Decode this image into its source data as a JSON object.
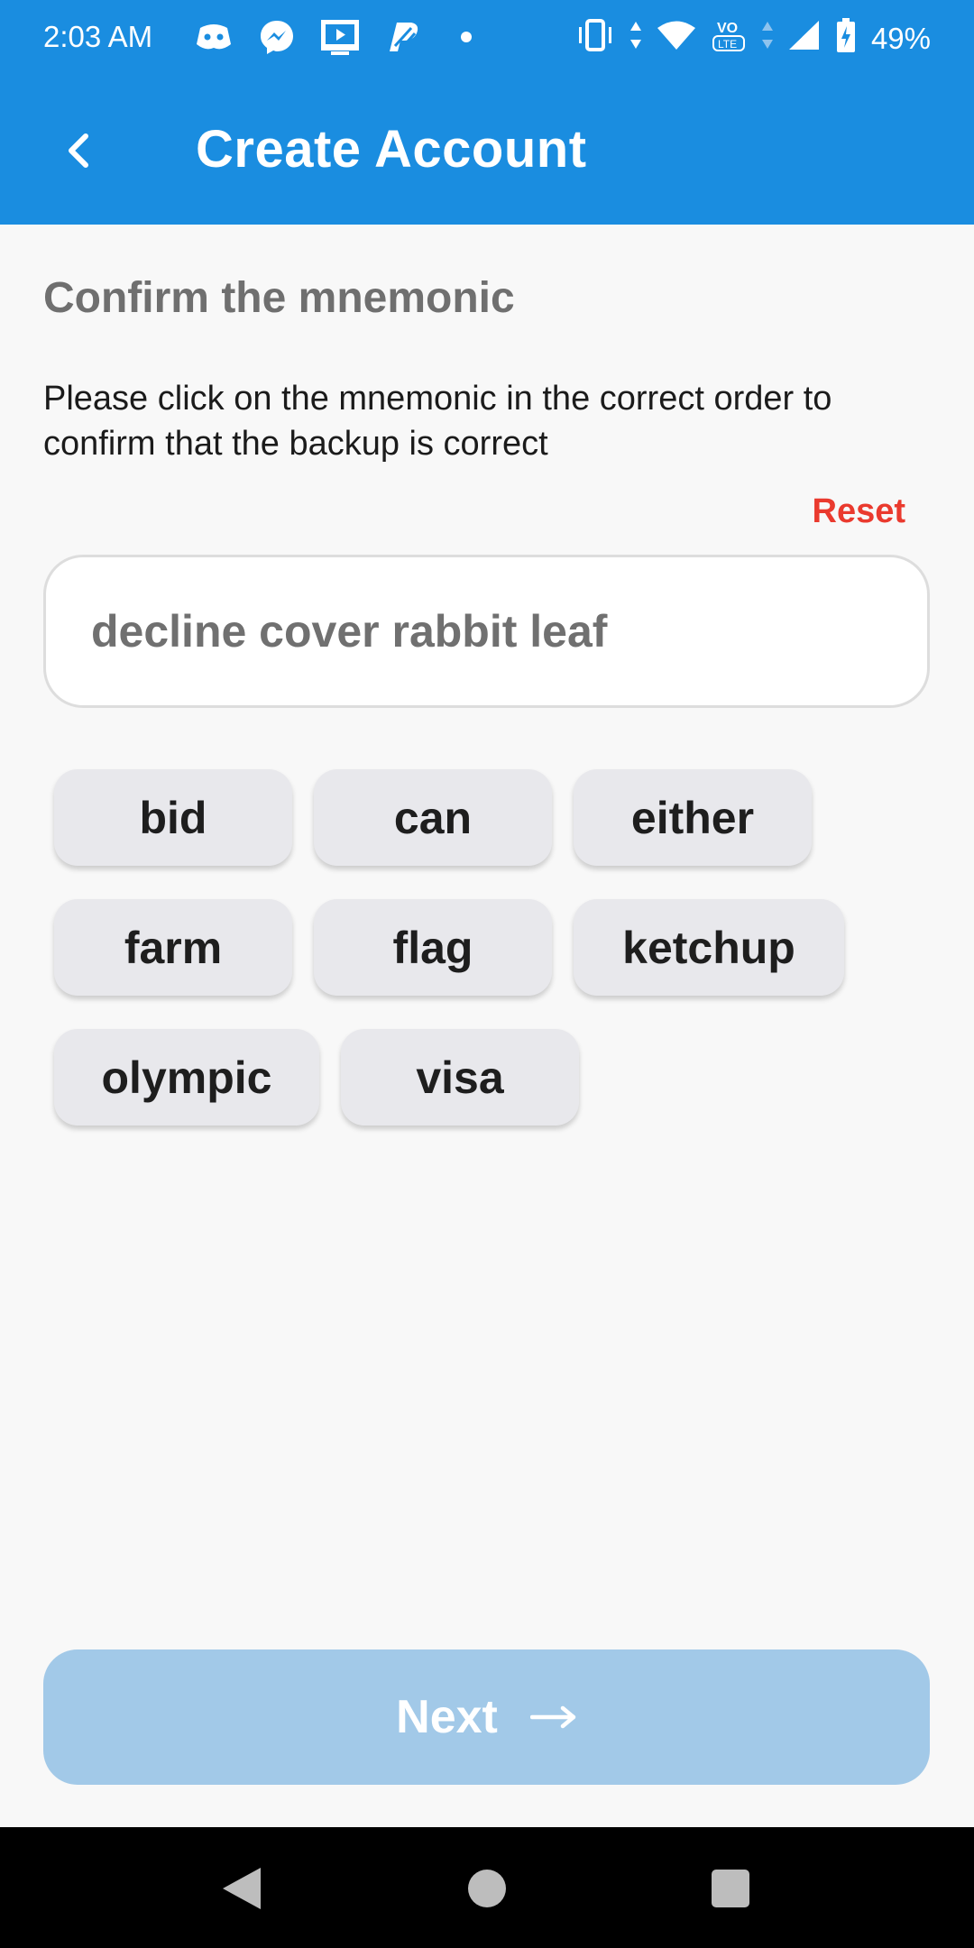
{
  "status": {
    "time": "2:03 AM",
    "battery": "49%",
    "app_icons": [
      "discord-icon",
      "messenger-icon",
      "video-app-icon",
      "paypal-icon",
      "dot-icon"
    ],
    "system_icons": [
      "vibrate-icon",
      "data-arrows-icon",
      "wifi-icon",
      "volte-icon",
      "signal-icon",
      "battery-icon"
    ]
  },
  "header": {
    "title": "Create Account",
    "back_icon": "chevron-left-icon"
  },
  "main": {
    "section_title": "Confirm the mnemonic",
    "instructions": "Please click on the mnemonic in the correct order to confirm that the backup is correct",
    "reset_label": "Reset",
    "selected_phrase": "decline cover rabbit leaf",
    "words": [
      "bid",
      "can",
      "either",
      "farm",
      "flag",
      "ketchup",
      "olympic",
      "visa"
    ]
  },
  "footer": {
    "next_label": "Next",
    "next_icon": "arrow-right-icon"
  },
  "nav": {
    "back": "back-triangle-icon",
    "home": "home-circle-icon",
    "recents": "recents-square-icon"
  },
  "colors": {
    "primary": "#1a8de0",
    "reset": "#ea3a2e",
    "next_disabled": "#a2c9e8",
    "chip": "#e8e8ec"
  }
}
